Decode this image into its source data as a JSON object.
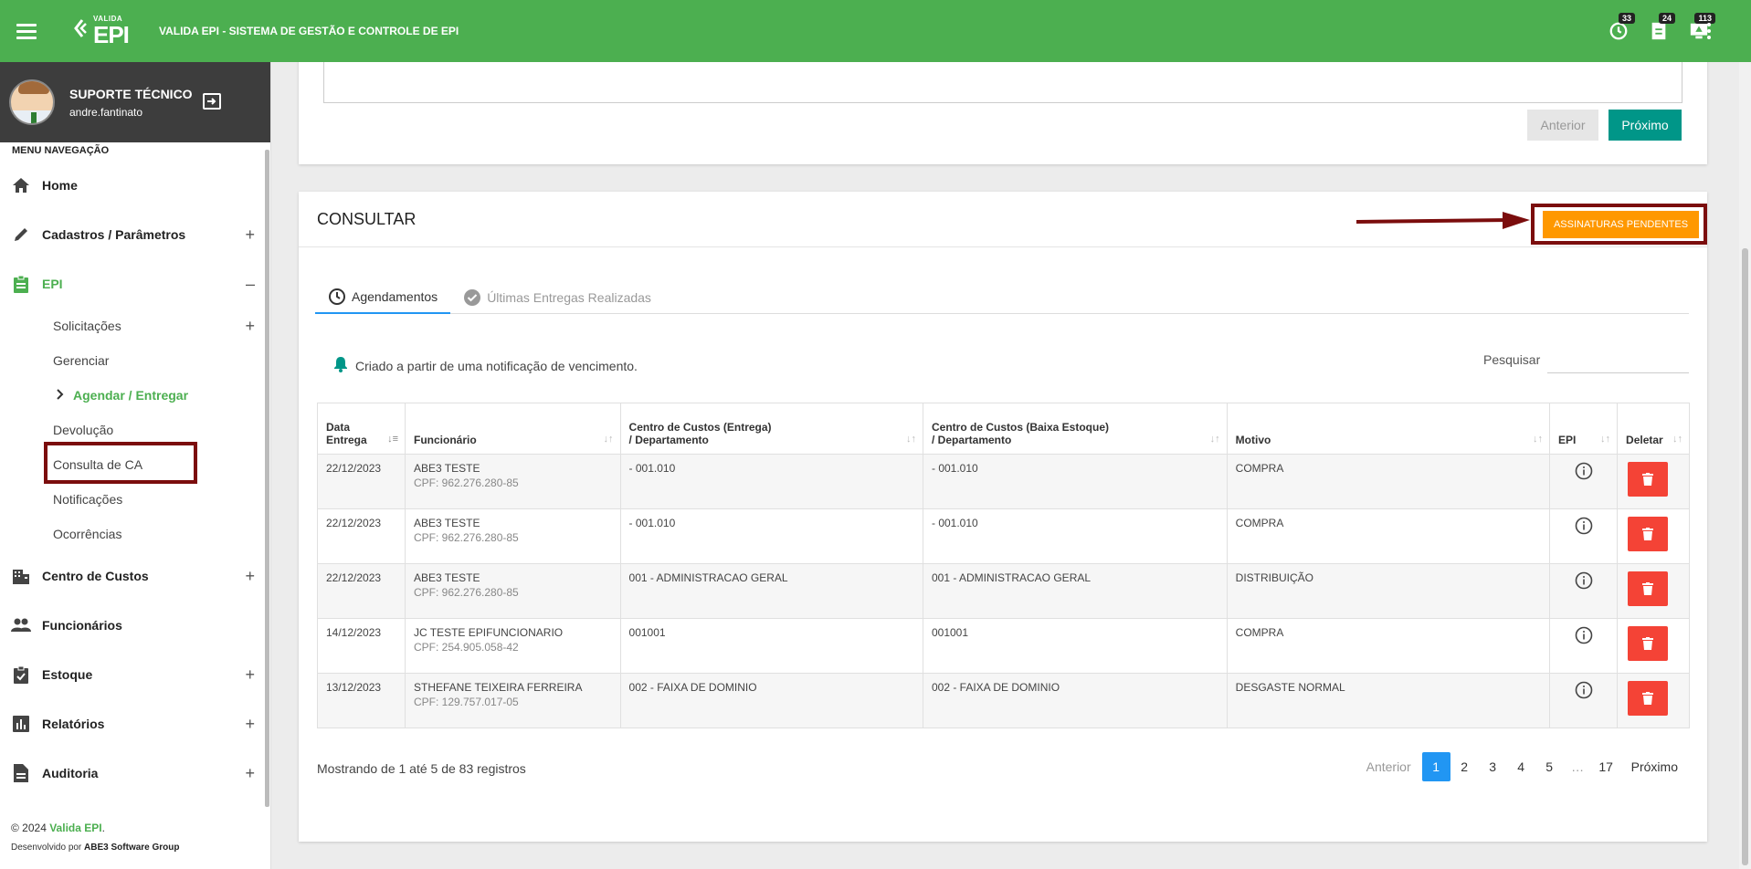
{
  "header": {
    "logo_small": "VALIDA",
    "logo_big": "EPI",
    "app_title": "VALIDA EPI - SISTEMA DE GESTÃO E CONTROLE DE EPI",
    "badges": {
      "history": "33",
      "documents": "24",
      "notifications": "113"
    }
  },
  "user": {
    "name": "SUPORTE TÉCNICO",
    "login": "andre.fantinato"
  },
  "sidebar": {
    "menu_header": "MENU NAVEGAÇÃO",
    "items": [
      {
        "label": "Home"
      },
      {
        "label": "Cadastros / Parâmetros"
      },
      {
        "label": "EPI"
      },
      {
        "label": "Centro de Custos"
      },
      {
        "label": "Funcionários"
      },
      {
        "label": "Estoque"
      },
      {
        "label": "Relatórios"
      },
      {
        "label": "Auditoria"
      }
    ],
    "epi_sub": [
      {
        "label": "Solicitações"
      },
      {
        "label": "Gerenciar"
      },
      {
        "label": "Agendar / Entregar"
      },
      {
        "label": "Devolução"
      },
      {
        "label": "Consulta de CA"
      },
      {
        "label": "Notificações"
      },
      {
        "label": "Ocorrências"
      }
    ],
    "footer": {
      "copyright": "© 2024",
      "brand": "Valida EPI",
      "dot": ".",
      "dev_prefix": "Desenvolvido por",
      "dev_name": "ABE3 Software Group"
    }
  },
  "top_card": {
    "prev_label": "Anterior",
    "next_label": "Próximo"
  },
  "consult": {
    "title": "CONSULTAR",
    "pending_button": "ASSINATURAS PENDENTES",
    "tabs": [
      "Agendamentos",
      "Últimas Entregas Realizadas"
    ],
    "notice": "Criado a partir de uma notificação de vencimento.",
    "search_label": "Pesquisar",
    "search_value": "",
    "columns": {
      "date_l1": "Data",
      "date_l2": "Entrega",
      "employee": "Funcionário",
      "cc_delivery_l1": "Centro de Custos (Entrega)",
      "cc_delivery_l2": "/ Departamento",
      "cc_stock_l1": "Centro de Custos (Baixa Estoque)",
      "cc_stock_l2": "/ Departamento",
      "reason": "Motivo",
      "epi": "EPI",
      "delete": "Deletar"
    },
    "rows": [
      {
        "date": "22/12/2023",
        "name": "ABE3 TESTE",
        "cpf": "CPF: 962.276.280-85",
        "cc_delivery": "- 001.010",
        "cc_stock": "- 001.010",
        "reason": "COMPRA"
      },
      {
        "date": "22/12/2023",
        "name": "ABE3 TESTE",
        "cpf": "CPF: 962.276.280-85",
        "cc_delivery": "- 001.010",
        "cc_stock": "- 001.010",
        "reason": "COMPRA"
      },
      {
        "date": "22/12/2023",
        "name": "ABE3 TESTE",
        "cpf": "CPF: 962.276.280-85",
        "cc_delivery": "001 - ADMINISTRACAO GERAL",
        "cc_stock": "001 - ADMINISTRACAO GERAL",
        "reason": "DISTRIBUIÇÃO"
      },
      {
        "date": "14/12/2023",
        "name": "JC TESTE EPIFUNCIONARIO",
        "cpf": "CPF: 254.905.058-42",
        "cc_delivery": "001001",
        "cc_stock": "001001",
        "reason": "COMPRA"
      },
      {
        "date": "13/12/2023",
        "name": "STHEFANE TEIXEIRA FERREIRA",
        "cpf": "CPF: 129.757.017-05",
        "cc_delivery": "002 - FAIXA DE DOMINIO",
        "cc_stock": "002 - FAIXA DE DOMINIO",
        "reason": "DESGASTE NORMAL"
      }
    ],
    "records_info": "Mostrando de 1 até 5 de 83 registros",
    "pagination": {
      "prev": "Anterior",
      "pages": [
        "1",
        "2",
        "3",
        "4",
        "5",
        "…",
        "17"
      ],
      "current": "1",
      "next": "Próximo"
    }
  },
  "colors": {
    "primary": "#4caf50",
    "teal": "#009688",
    "orange": "#ff9800",
    "red": "#f44336",
    "blue": "#2196f3",
    "highlight": "#7b0d0d"
  }
}
